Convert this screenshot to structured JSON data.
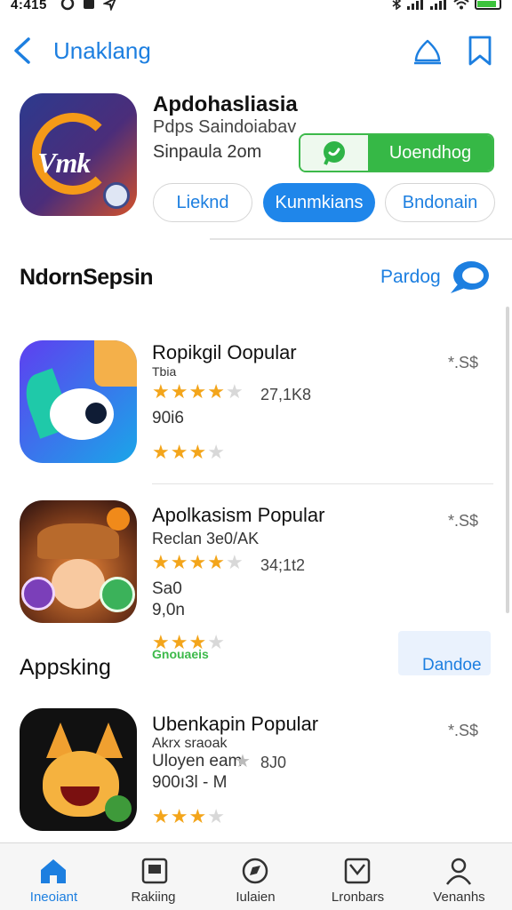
{
  "status_bar": {
    "time": "4:415"
  },
  "nav": {
    "title": "Unaklang"
  },
  "hero": {
    "title": "Apdohasliasia",
    "subtitle": "Pdps Saindoiabav",
    "meta": "Sinpaula 2om",
    "icon_text": "Vmk",
    "install_label": "Uoendhog",
    "pills": [
      "Lieknd",
      "Kunmkians",
      "Bndonain"
    ]
  },
  "section": {
    "title": "NdornSepsin",
    "link": "Pardog"
  },
  "apps": [
    {
      "title": "Ropikgil Oopular",
      "sub": "Tbia",
      "price": "*.S$",
      "rating_count": "27,1K8",
      "extra": "90i6",
      "stars_primary": 4,
      "stars_secondary": 3
    },
    {
      "title": "Apolkasism Popular",
      "sub": "Reclan 3e0/AK",
      "price": "*.S$",
      "rating_count": "34;1t2",
      "extra": "Sa0",
      "extra2": "9,0n",
      "stars_primary": 4,
      "stars_secondary": 3
    },
    {
      "title": "Ubenkapin Popular",
      "sub": "Akrx sraoak",
      "price": "*.S$",
      "line2": "Uloyen eam",
      "rating_count": "8J0",
      "extra": "900ı3l - Μ",
      "stars_secondary": 3
    }
  ],
  "middle": {
    "section_label": "Appsking",
    "green_label": "Gnouaeis",
    "button_label": "Dandoe"
  },
  "tabs": [
    {
      "label": "Ineoiant",
      "icon": "home-icon",
      "active": true
    },
    {
      "label": "Rakiing",
      "icon": "ranking-icon",
      "active": false
    },
    {
      "label": "Iulaien",
      "icon": "explore-icon",
      "active": false
    },
    {
      "label": "Lronbars",
      "icon": "inbox-icon",
      "active": false
    },
    {
      "label": "Venanhs",
      "icon": "profile-icon",
      "active": false
    }
  ],
  "colors": {
    "accent": "#1d7fe0",
    "install_green": "#36b846",
    "star": "#f3a51b"
  }
}
